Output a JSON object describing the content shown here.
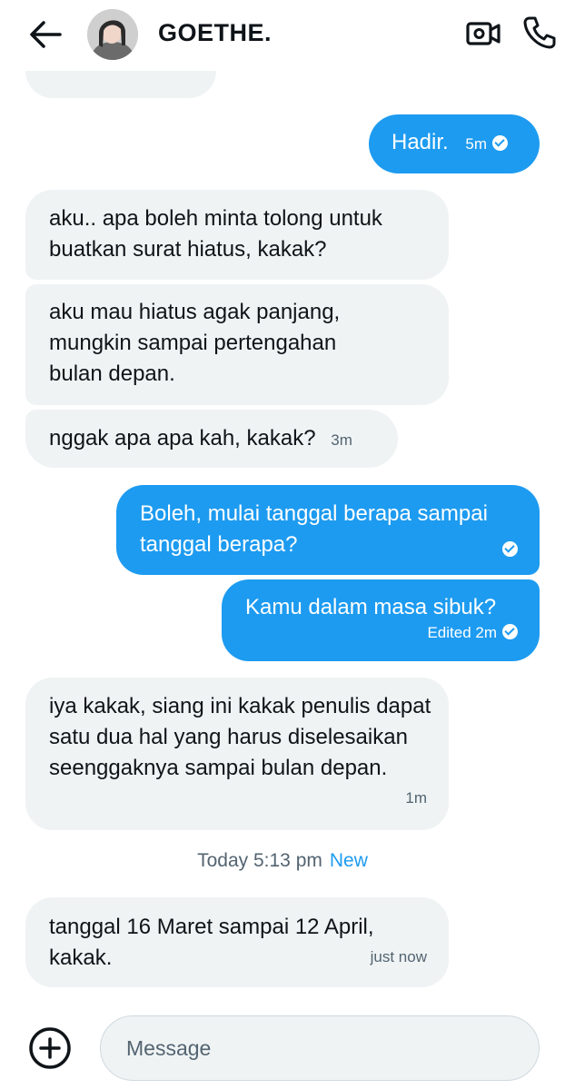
{
  "header": {
    "contact_name": "GOETHE.",
    "icons": {
      "back": "arrow-left-icon",
      "video": "video-call-icon",
      "phone": "phone-icon"
    }
  },
  "messages": [
    {
      "direction": "out",
      "text": "Hadir.",
      "time": "5m",
      "status": "seen"
    },
    {
      "direction": "in",
      "text": "aku.. apa boleh minta tolong untuk buatkan surat hiatus, kakak?"
    },
    {
      "direction": "in",
      "text": "aku mau hiatus agak panjang, mungkin sampai pertengahan bulan depan."
    },
    {
      "direction": "in",
      "text": "nggak apa apa kah, kakak?",
      "time": "3m"
    },
    {
      "direction": "out",
      "text": "Boleh, mulai tanggal berapa sampai tanggal berapa?",
      "status": "seen"
    },
    {
      "direction": "out",
      "text": "Kamu dalam masa sibuk?",
      "time": "Edited 2m",
      "status": "seen"
    },
    {
      "direction": "in",
      "text": "iya kakak, siang ini kakak penulis dapat satu dua hal yang harus diselesaikan seenggaknya sampai bulan depan.",
      "time": "1m"
    },
    {
      "direction": "in",
      "text": "tanggal 16 Maret sampai 12 April, kakak.",
      "time": "just now"
    }
  ],
  "divider": {
    "label": "Today 5:13 pm",
    "badge": "New"
  },
  "composer": {
    "placeholder": "Message",
    "add_icon": "plus-circle-icon"
  },
  "colors": {
    "accent": "#1d9bf0",
    "incoming_bubble": "#eff3f4",
    "text": "#0f1419",
    "muted": "#536471"
  }
}
